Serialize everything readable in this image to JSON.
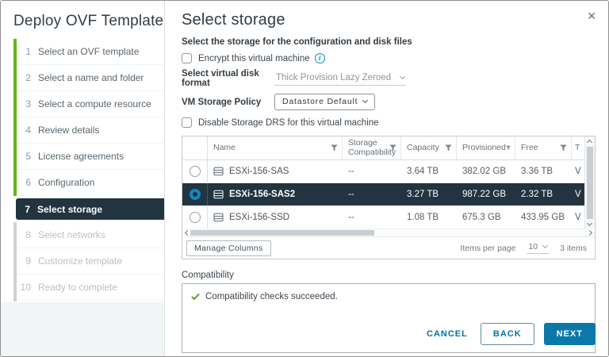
{
  "dialog": {
    "close_glyph": "✕"
  },
  "sidebar": {
    "title": "Deploy OVF Template",
    "steps": [
      {
        "num": "1",
        "label": "Select an OVF template",
        "state": "done"
      },
      {
        "num": "2",
        "label": "Select a name and folder",
        "state": "done"
      },
      {
        "num": "3",
        "label": "Select a compute resource",
        "state": "done"
      },
      {
        "num": "4",
        "label": "Review details",
        "state": "done"
      },
      {
        "num": "5",
        "label": "License agreements",
        "state": "done"
      },
      {
        "num": "6",
        "label": "Configuration",
        "state": "done"
      },
      {
        "num": "7",
        "label": "Select storage",
        "state": "active"
      },
      {
        "num": "8",
        "label": "Select networks",
        "state": "future"
      },
      {
        "num": "9",
        "label": "Customize template",
        "state": "future"
      },
      {
        "num": "10",
        "label": "Ready to complete",
        "state": "future"
      }
    ]
  },
  "main": {
    "title": "Select storage",
    "subtitle": "Select the storage for the configuration and disk files",
    "encrypt_checkbox_label": "Encrypt this virtual machine",
    "info_glyph": "i",
    "disk_format_label": "Select virtual disk format",
    "disk_format_value": "Thick Provision Lazy Zeroed",
    "storage_policy_label": "VM Storage Policy",
    "storage_policy_value": "Datastore Default",
    "drs_checkbox_label": "Disable Storage DRS for this virtual machine"
  },
  "table": {
    "columns": {
      "name": "Name",
      "storage_compatibility": "Storage Compatibility",
      "capacity": "Capacity",
      "provisioned": "Provisioned",
      "free": "Free",
      "type_truncated": "T"
    },
    "rows": [
      {
        "name": "ESXi-156-SAS",
        "storage_compatibility": "--",
        "capacity": "3.64 TB",
        "provisioned": "382.02 GB",
        "free": "3.36 TB",
        "type_truncated": "V",
        "selected": false
      },
      {
        "name": "ESXi-156-SAS2",
        "storage_compatibility": "--",
        "capacity": "3.27 TB",
        "provisioned": "987.22 GB",
        "free": "2.32 TB",
        "type_truncated": "V",
        "selected": true
      },
      {
        "name": "ESXi-156-SSD",
        "storage_compatibility": "--",
        "capacity": "1.08 TB",
        "provisioned": "675.3 GB",
        "free": "433.95 GB",
        "type_truncated": "V",
        "selected": false
      }
    ],
    "footer": {
      "manage_columns": "Manage Columns",
      "items_per_page_label": "Items per page",
      "items_per_page_value": "10",
      "items_count": "3 items"
    }
  },
  "compatibility": {
    "label": "Compatibility",
    "message": "Compatibility checks succeeded."
  },
  "buttons": {
    "cancel": "CANCEL",
    "back": "BACK",
    "next": "NEXT"
  },
  "colors": {
    "accent_blue": "#0b78aa",
    "selection_dark": "#22343f",
    "progress_green": "#61b715",
    "progress_gray": "#ccd2d6",
    "success_green": "#5aa220"
  }
}
